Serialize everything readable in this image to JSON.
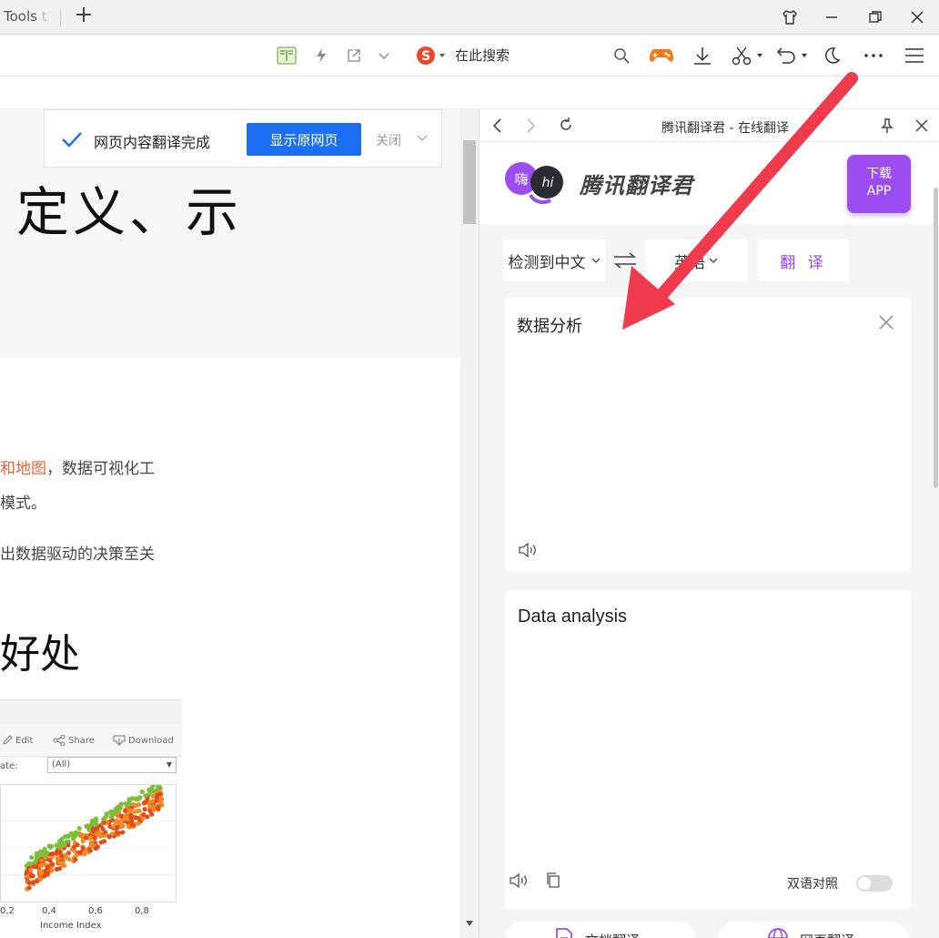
{
  "tabbar": {
    "tab_label": "Tools",
    "tab_label_fade": "t"
  },
  "toolbar": {
    "search_placeholder": "在此搜索"
  },
  "page": {
    "notice_text": "网页内容翻译完成",
    "show_original": "显示原网页",
    "close": "关闭",
    "hero_title": "定义、示",
    "para1_highlight": "和地图",
    "para1_rest": "，数据可视化工",
    "para2": "模式。",
    "para3": "出数据驱动的决策至关",
    "section_heading": "好处"
  },
  "embed": {
    "edit": "Edit",
    "share": "Share",
    "download": "Download",
    "state_label": "ate:",
    "state_value": "(All)",
    "xticks": [
      "0,2",
      "0,4",
      "0,6",
      "0,8"
    ],
    "xlabel": "Income Index"
  },
  "panel": {
    "title": "腾讯翻译君 - 在线翻译",
    "brand": "腾讯翻译君",
    "logo_left": "嗨",
    "logo_right": "hi",
    "download_line1": "下载",
    "download_line2": "APP",
    "source_lang": "检测到中文",
    "target_lang": "英语",
    "translate": "翻 译",
    "source_text": "数据分析",
    "output_text": "Data analysis",
    "bilingual": "双语对照",
    "bottom_tab1": "文档翻译",
    "bottom_tab2": "网页翻译"
  },
  "colors": {
    "accent_blue": "#1c6ef2",
    "accent_purple": "#9b4df0",
    "arrow_red": "#ef3b4c",
    "highlight_orange": "#e0663a"
  }
}
